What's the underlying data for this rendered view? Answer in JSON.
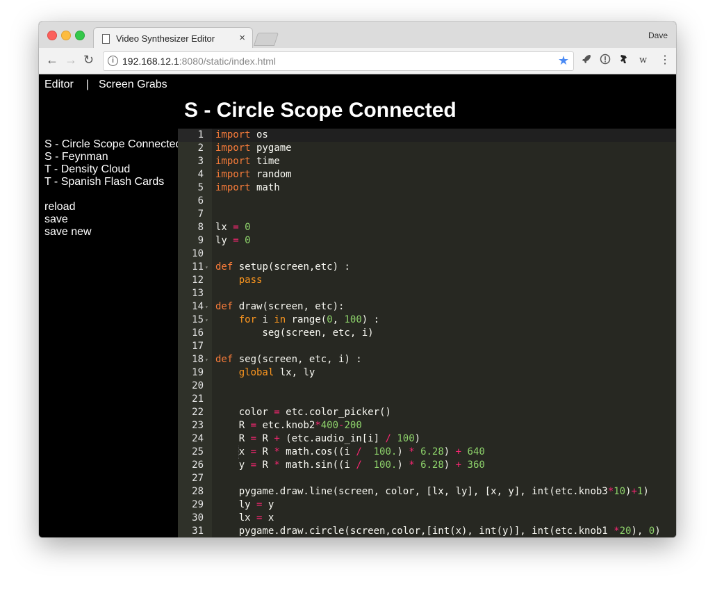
{
  "browser": {
    "tab_title": "Video Synthesizer Editor",
    "tab_close": "×",
    "profile_name": "Dave",
    "url_host": "192.168.12.1",
    "url_rest": ":8080/static/index.html",
    "back": "←",
    "forward": "→",
    "reload": "↻",
    "star": "★",
    "menu": "⋮",
    "ext_w": "w"
  },
  "nav": {
    "editor": "Editor",
    "separator": "|",
    "screen_grabs": "Screen Grabs"
  },
  "page_title": "S - Circle Scope Connected",
  "sidebar": {
    "files": [
      "S - Circle Scope Connected",
      "S - Feynman",
      "T - Density Cloud",
      "T - Spanish Flash Cards"
    ],
    "actions": [
      "reload",
      "save",
      "save new"
    ]
  },
  "editor": {
    "lines": [
      {
        "n": "1",
        "t": [
          [
            "kw",
            "import"
          ],
          [
            "p",
            " os"
          ]
        ]
      },
      {
        "n": "2",
        "t": [
          [
            "kw",
            "import"
          ],
          [
            "p",
            " pygame"
          ]
        ]
      },
      {
        "n": "3",
        "t": [
          [
            "kw",
            "import"
          ],
          [
            "p",
            " time"
          ]
        ]
      },
      {
        "n": "4",
        "t": [
          [
            "kw",
            "import"
          ],
          [
            "p",
            " random"
          ]
        ]
      },
      {
        "n": "5",
        "t": [
          [
            "kw",
            "import"
          ],
          [
            "p",
            " math"
          ]
        ]
      },
      {
        "n": "6",
        "t": []
      },
      {
        "n": "7",
        "t": []
      },
      {
        "n": "8",
        "t": [
          [
            "p",
            "lx "
          ],
          [
            "o",
            "="
          ],
          [
            "p",
            " "
          ],
          [
            "n",
            "0"
          ]
        ]
      },
      {
        "n": "9",
        "t": [
          [
            "p",
            "ly "
          ],
          [
            "o",
            "="
          ],
          [
            "p",
            " "
          ],
          [
            "n",
            "0"
          ]
        ]
      },
      {
        "n": "10",
        "t": []
      },
      {
        "n": "11",
        "fold": true,
        "t": [
          [
            "kw",
            "def"
          ],
          [
            "p",
            " setup(screen,etc) :"
          ]
        ]
      },
      {
        "n": "12",
        "t": [
          [
            "p",
            "    "
          ],
          [
            "kwd",
            "pass"
          ]
        ]
      },
      {
        "n": "13",
        "t": []
      },
      {
        "n": "14",
        "fold": true,
        "t": [
          [
            "kw",
            "def"
          ],
          [
            "p",
            " draw(screen, etc):"
          ]
        ]
      },
      {
        "n": "15",
        "fold": true,
        "t": [
          [
            "p",
            "    "
          ],
          [
            "kwd",
            "for"
          ],
          [
            "p",
            " i "
          ],
          [
            "kwd",
            "in"
          ],
          [
            "p",
            " range("
          ],
          [
            "n",
            "0"
          ],
          [
            "p",
            ", "
          ],
          [
            "n",
            "100"
          ],
          [
            "p",
            ") :"
          ]
        ]
      },
      {
        "n": "16",
        "t": [
          [
            "p",
            "        seg(screen, etc, i)"
          ]
        ]
      },
      {
        "n": "17",
        "t": []
      },
      {
        "n": "18",
        "fold": true,
        "t": [
          [
            "kw",
            "def"
          ],
          [
            "p",
            " seg(screen, etc, i) :"
          ]
        ]
      },
      {
        "n": "19",
        "t": [
          [
            "p",
            "    "
          ],
          [
            "kwd",
            "global"
          ],
          [
            "p",
            " lx, ly"
          ]
        ]
      },
      {
        "n": "20",
        "t": []
      },
      {
        "n": "21",
        "t": []
      },
      {
        "n": "22",
        "t": [
          [
            "p",
            "    color "
          ],
          [
            "o",
            "="
          ],
          [
            "p",
            " etc.color_picker()"
          ]
        ]
      },
      {
        "n": "23",
        "t": [
          [
            "p",
            "    R "
          ],
          [
            "o",
            "="
          ],
          [
            "p",
            " etc.knob2"
          ],
          [
            "o",
            "*"
          ],
          [
            "n",
            "400"
          ],
          [
            "o",
            "-"
          ],
          [
            "n",
            "200"
          ]
        ]
      },
      {
        "n": "24",
        "t": [
          [
            "p",
            "    R "
          ],
          [
            "o",
            "="
          ],
          [
            "p",
            " R "
          ],
          [
            "o",
            "+"
          ],
          [
            "p",
            " (etc.audio_in[i] "
          ],
          [
            "o",
            "/"
          ],
          [
            "p",
            " "
          ],
          [
            "n",
            "100"
          ],
          [
            "p",
            ")"
          ]
        ]
      },
      {
        "n": "25",
        "t": [
          [
            "p",
            "    x "
          ],
          [
            "o",
            "="
          ],
          [
            "p",
            " R "
          ],
          [
            "o",
            "*"
          ],
          [
            "p",
            " math.cos((i "
          ],
          [
            "o",
            "/"
          ],
          [
            "p",
            "  "
          ],
          [
            "n",
            "100."
          ],
          [
            "p",
            ") "
          ],
          [
            "o",
            "*"
          ],
          [
            "p",
            " "
          ],
          [
            "n",
            "6.28"
          ],
          [
            "p",
            ") "
          ],
          [
            "o",
            "+"
          ],
          [
            "p",
            " "
          ],
          [
            "n",
            "640"
          ]
        ]
      },
      {
        "n": "26",
        "t": [
          [
            "p",
            "    y "
          ],
          [
            "o",
            "="
          ],
          [
            "p",
            " R "
          ],
          [
            "o",
            "*"
          ],
          [
            "p",
            " math.sin((i "
          ],
          [
            "o",
            "/"
          ],
          [
            "p",
            "  "
          ],
          [
            "n",
            "100."
          ],
          [
            "p",
            ") "
          ],
          [
            "o",
            "*"
          ],
          [
            "p",
            " "
          ],
          [
            "n",
            "6.28"
          ],
          [
            "p",
            ") "
          ],
          [
            "o",
            "+"
          ],
          [
            "p",
            " "
          ],
          [
            "n",
            "360"
          ]
        ]
      },
      {
        "n": "27",
        "t": []
      },
      {
        "n": "28",
        "t": [
          [
            "p",
            "    pygame.draw.line(screen, color, [lx, ly], [x, y], int(etc.knob3"
          ],
          [
            "o",
            "*"
          ],
          [
            "n",
            "10"
          ],
          [
            "p",
            ")"
          ],
          [
            "o",
            "+"
          ],
          [
            "n",
            "1"
          ],
          [
            "p",
            ")"
          ]
        ]
      },
      {
        "n": "29",
        "t": [
          [
            "p",
            "    ly "
          ],
          [
            "o",
            "="
          ],
          [
            "p",
            " y"
          ]
        ]
      },
      {
        "n": "30",
        "t": [
          [
            "p",
            "    lx "
          ],
          [
            "o",
            "="
          ],
          [
            "p",
            " x"
          ]
        ]
      },
      {
        "n": "31",
        "t": [
          [
            "p",
            "    pygame.draw.circle(screen,color,[int(x), int(y)], int(etc.knob1 "
          ],
          [
            "o",
            "*"
          ],
          [
            "n",
            "20"
          ],
          [
            "p",
            "), "
          ],
          [
            "n",
            "0"
          ],
          [
            "p",
            ")"
          ]
        ]
      }
    ]
  }
}
